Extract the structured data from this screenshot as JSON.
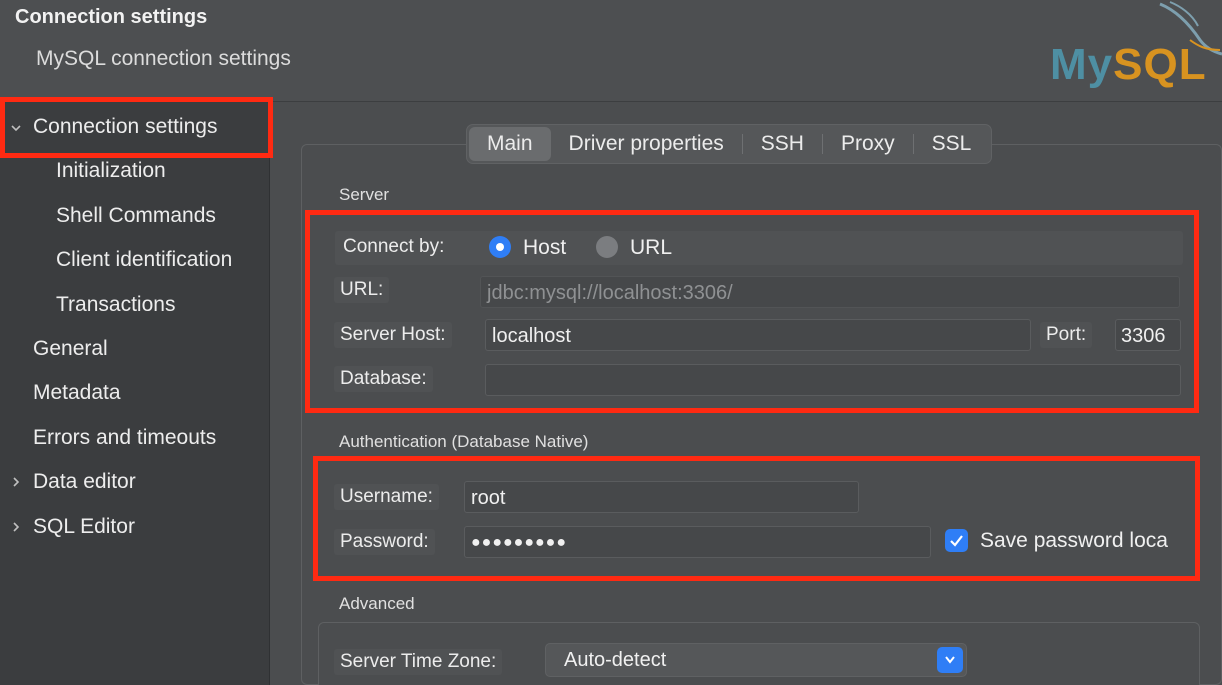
{
  "header": {
    "title": "Connection settings",
    "subtitle": "MySQL connection settings",
    "logo_text_a": "My",
    "logo_text_b": "SQL"
  },
  "sidebar": {
    "items": [
      {
        "label": "Connection settings",
        "expanded": true
      },
      {
        "label": "Initialization"
      },
      {
        "label": "Shell Commands"
      },
      {
        "label": "Client identification"
      },
      {
        "label": "Transactions"
      },
      {
        "label": "General"
      },
      {
        "label": "Metadata"
      },
      {
        "label": "Errors and timeouts"
      },
      {
        "label": "Data editor",
        "expandable": true
      },
      {
        "label": "SQL Editor",
        "expandable": true
      }
    ]
  },
  "tabs": [
    {
      "label": "Main",
      "active": true
    },
    {
      "label": "Driver properties"
    },
    {
      "label": "SSH"
    },
    {
      "label": "Proxy"
    },
    {
      "label": "SSL"
    }
  ],
  "server": {
    "section": "Server",
    "connect_by_label": "Connect by:",
    "option_host": "Host",
    "option_url": "URL",
    "selected": "Host",
    "url_label": "URL:",
    "url_value": "jdbc:mysql://localhost:3306/",
    "host_label": "Server Host:",
    "host_value": "localhost",
    "port_label": "Port:",
    "port_value": "3306",
    "database_label": "Database:",
    "database_value": ""
  },
  "auth": {
    "section": "Authentication (Database Native)",
    "username_label": "Username:",
    "username_value": "root",
    "password_label": "Password:",
    "password_value": "●●●●●●●●●",
    "save_password_label": "Save password loca",
    "save_password_checked": true
  },
  "advanced": {
    "section": "Advanced",
    "timezone_label": "Server Time Zone:",
    "timezone_value": "Auto-detect"
  },
  "colors": {
    "highlight": "#ff2a12",
    "accent": "#2f7ef6"
  }
}
